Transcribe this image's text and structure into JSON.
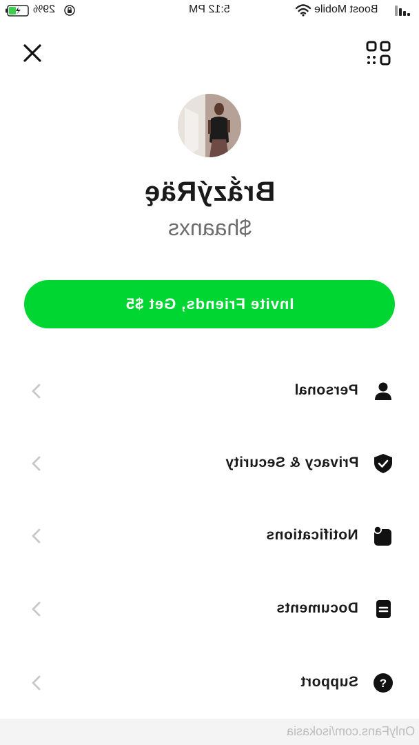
{
  "status_bar": {
    "battery_percent": "29%",
    "time": "5:12 PM",
    "carrier": "Boost Mobile"
  },
  "profile": {
    "display_name": "BrắzýRäę",
    "cashtag": "$haanxs"
  },
  "invite": {
    "label": "Invite Friends, Get $5"
  },
  "menu": [
    {
      "label": "Personal",
      "icon": "person-icon"
    },
    {
      "label": "Privacy & Security",
      "icon": "shield-icon"
    },
    {
      "label": "Notifications",
      "icon": "notification-icon"
    },
    {
      "label": "Documents",
      "icon": "document-icon"
    },
    {
      "label": "Support",
      "icon": "help-icon"
    }
  ],
  "watermark": "OnlyFans.com/isokasia",
  "colors": {
    "accent": "#00d632"
  }
}
